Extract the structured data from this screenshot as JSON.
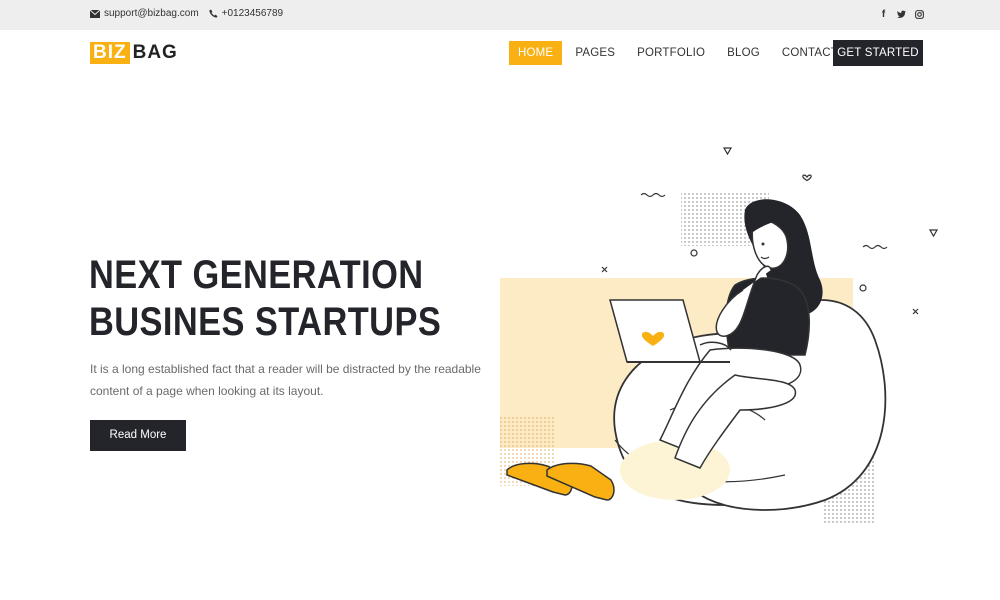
{
  "topbar": {
    "email": "support@bizbag.com",
    "phone": "+0123456789",
    "social": [
      {
        "icon": "facebook-icon",
        "glyph": "f"
      },
      {
        "icon": "twitter-icon",
        "glyph": "🐦"
      },
      {
        "icon": "instagram-icon",
        "glyph": "◎"
      }
    ]
  },
  "logo": {
    "part1": "BIZ",
    "part2": "BAG"
  },
  "nav": {
    "items": [
      "HOME",
      "PAGES",
      "PORTFOLIO",
      "BLOG",
      "CONTACT US"
    ],
    "active_index": 0,
    "cta": "GET STARTED"
  },
  "hero": {
    "title_line1": "NEXT GENERATION",
    "title_line2": "BUSINES STARTUPS",
    "text": "It is a long established fact that a reader will be distracted by the readable content of a page when looking at its layout.",
    "button": "Read More"
  },
  "colors": {
    "accent": "#f8b012",
    "dark": "#23252b",
    "topbar_bg": "#eeeeef",
    "illustration_bg": "#fdebc6"
  }
}
